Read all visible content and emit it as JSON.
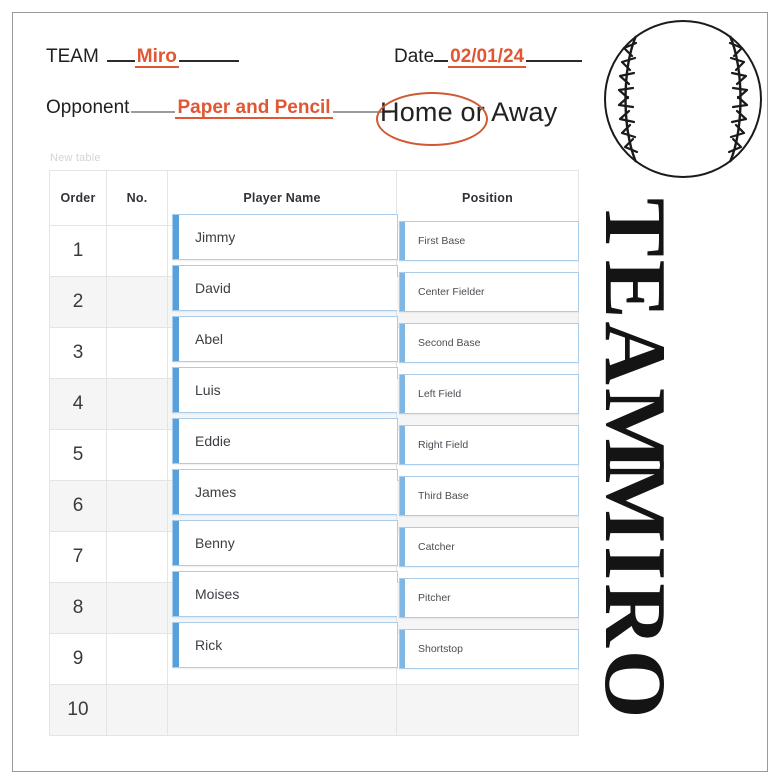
{
  "header": {
    "team_label": "TEAM",
    "team_value": "Miro",
    "opponent_label": "Opponent",
    "opponent_value": "Paper and Pencil",
    "date_label": "Date",
    "date_value": "02/01/24",
    "home_away_text": "Home or Away",
    "circled_option": "Home"
  },
  "decor": {
    "baseball_icon": "baseball-icon",
    "vertical_word_1": "TEAM",
    "vertical_word_2": "MIRO"
  },
  "table": {
    "caption": "New table",
    "columns": [
      "Order",
      "No.",
      "Player Name",
      "Position"
    ],
    "rows": [
      {
        "order": "1",
        "no": "",
        "name": "Jimmy",
        "position": "First Base"
      },
      {
        "order": "2",
        "no": "",
        "name": "David",
        "position": "Center Fielder"
      },
      {
        "order": "3",
        "no": "",
        "name": "Abel",
        "position": "Second Base"
      },
      {
        "order": "4",
        "no": "",
        "name": "Luis",
        "position": "Left Field"
      },
      {
        "order": "5",
        "no": "",
        "name": "Eddie",
        "position": "Right Field"
      },
      {
        "order": "6",
        "no": "",
        "name": "James",
        "position": "Third Base"
      },
      {
        "order": "7",
        "no": "",
        "name": "Benny",
        "position": "Catcher"
      },
      {
        "order": "8",
        "no": "",
        "name": "Moises",
        "position": "Pitcher"
      },
      {
        "order": "9",
        "no": "",
        "name": "Rick",
        "position": "Shortstop"
      },
      {
        "order": "10",
        "no": "",
        "name": "",
        "position": ""
      }
    ]
  },
  "colors": {
    "accent_orange": "#e05733",
    "card_blue": "#58a0dc",
    "card_border_blue": "#a9cdea",
    "frame_grey": "#9a9a9e",
    "row_alt_grey": "#f5f5f6"
  }
}
